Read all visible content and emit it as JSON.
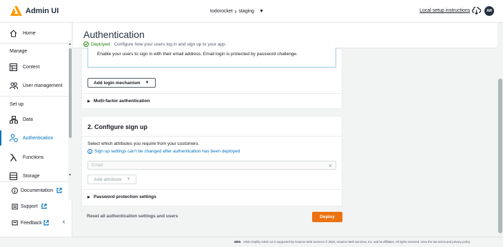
{
  "app": {
    "title": "Admin UI",
    "accent": "#ff9900"
  },
  "topbar": {
    "project": "todorocket",
    "separator": "›",
    "environment": "staging",
    "setup_link": "Local setup instructions",
    "avatar": "AW"
  },
  "sidebar": {
    "home": "Home",
    "manage_title": "Manage",
    "content": "Content",
    "user_management": "User management",
    "setup_title": "Set up",
    "data": "Data",
    "authentication": "Authentication",
    "functions": "Functions",
    "storage": "Storage",
    "footer": {
      "documentation": "Documentation",
      "support": "Support",
      "feedback": "Feedback"
    }
  },
  "header": {
    "title": "Authentication",
    "status": "Deployed",
    "description": "Configure how your users log in and sign up to your app."
  },
  "login": {
    "email_info": "Enable your users to sign in with their email address. Email login is protected by password challenge.",
    "add_mechanism": "Add login mechanism",
    "mfa": "Multi-factor authentication"
  },
  "signup": {
    "heading": "2. Configure sign up",
    "prompt": "Select which attributes you require from your customers.",
    "info": "Sign up settings can't be changed after authentication has been deployed",
    "email_placeholder": "Email",
    "add_attribute": "Add attribute",
    "password_settings": "Password protection settings"
  },
  "bottom": {
    "reset": "Reset all authentication settings and users",
    "deploy": "Deploy",
    "deploy_color": "#ec7211"
  },
  "footer": {
    "aws": "aws",
    "text": "AWS Amplify Admin UI is supported by Amazon Web Services © 2020, Amazon Web Services, Inc. and its affiliates. All rights reserved. View the site terms and privacy policy"
  }
}
